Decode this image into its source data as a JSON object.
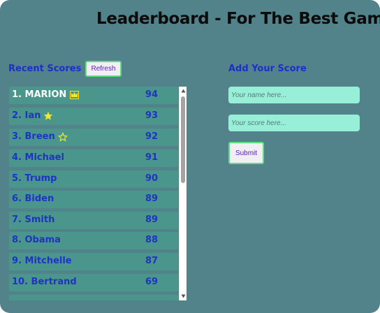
{
  "header": {
    "title": "Leaderboard - For The Best Gamers"
  },
  "recent": {
    "title": "Recent Scores",
    "refresh_label": "Refresh",
    "rows": [
      {
        "name": "1. MARION",
        "score": "94",
        "badge": "crown-icon"
      },
      {
        "name": "2. Ian",
        "score": "93",
        "badge": "star-filled-icon"
      },
      {
        "name": "3. Breen",
        "score": "92",
        "badge": "star-outline-icon"
      },
      {
        "name": "4. Michael",
        "score": "91"
      },
      {
        "name": "5. Trump",
        "score": "90"
      },
      {
        "name": "6. Biden",
        "score": "89"
      },
      {
        "name": "7. Smith",
        "score": "89"
      },
      {
        "name": "8. Obama",
        "score": "88"
      },
      {
        "name": "9. Mitchelle",
        "score": "87"
      },
      {
        "name": "10. Bertrand",
        "score": "69"
      }
    ]
  },
  "add": {
    "title": "Add Your Score",
    "name_placeholder": "Your name here...",
    "score_placeholder": "Your score here...",
    "submit_label": "Submit"
  },
  "colors": {
    "background": "#52838b",
    "row": "#4a968c",
    "accent_text": "#1d2fc8",
    "input": "#96efd6",
    "button_border": "#5ede7e",
    "badge": "#f5e52b"
  }
}
